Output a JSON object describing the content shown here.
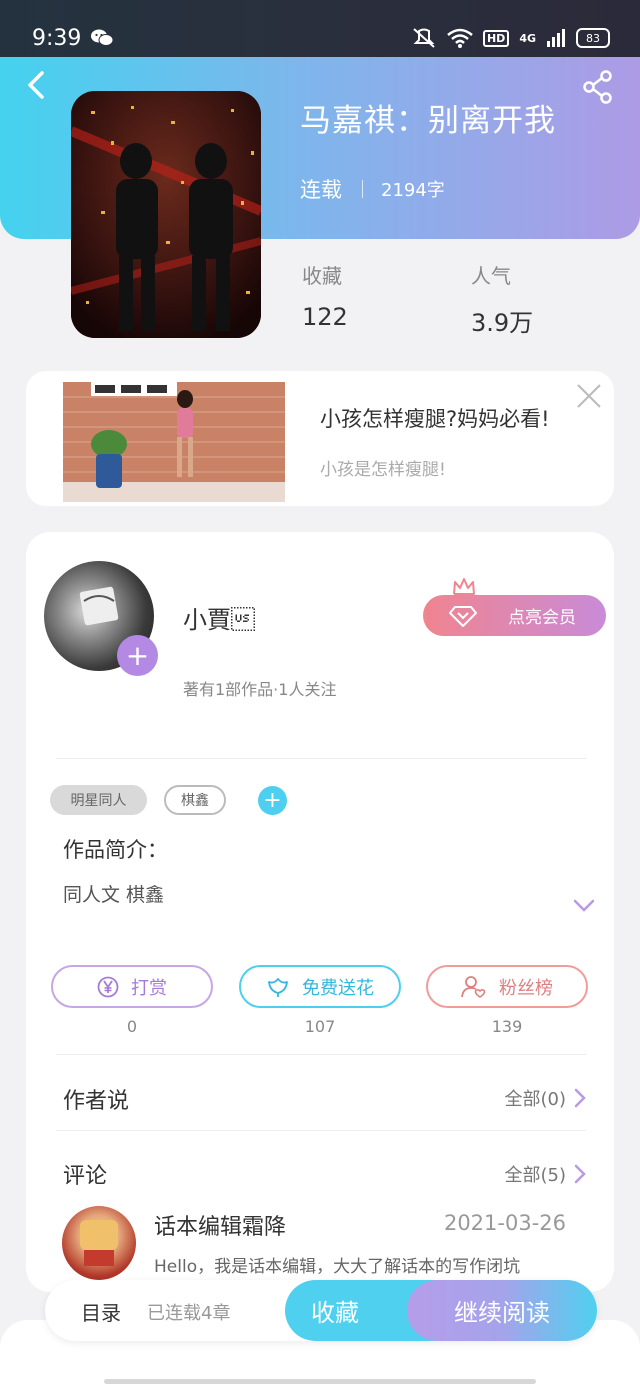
{
  "status_bar": {
    "time": "9:39",
    "network": "4G",
    "hd": "HD",
    "battery": "83"
  },
  "book": {
    "title": "马嘉祺：别离开我",
    "status": "连载",
    "word_count": "2194字"
  },
  "stats": [
    {
      "label": "收藏",
      "value": "122"
    },
    {
      "label": "人气",
      "value": "3.9万"
    }
  ],
  "ad": {
    "title": "小孩怎样瘦腿?妈妈必看!",
    "subtitle": "小孩是怎样瘦腿!"
  },
  "author": {
    "name": "小賈\u001f",
    "meta": "著有1部作品·1人关注",
    "vip_label": "点亮会员"
  },
  "tags": [
    "明星同人",
    "棋鑫"
  ],
  "intro": {
    "title": "作品简介：",
    "text": "同人文 棋鑫"
  },
  "actions": [
    {
      "label": "打赏",
      "count": "0",
      "icon": "yen-coin-icon"
    },
    {
      "label": "免费送花",
      "count": "107",
      "icon": "flower-icon"
    },
    {
      "label": "粉丝榜",
      "count": "139",
      "icon": "fan-user-icon"
    }
  ],
  "author_says": {
    "title": "作者说",
    "link": "全部(0)"
  },
  "comments": {
    "title": "评论",
    "link": "全部(5)",
    "items": [
      {
        "user": "话本编辑霜降",
        "date": "2021-03-26",
        "text": "Hello，我是话本编辑，大大了解话本的写作闭坑"
      }
    ]
  },
  "bottom": {
    "toc_label": "目录",
    "toc_sub": "已连载4章",
    "fav_label": "收藏",
    "read_label": "继续阅读"
  },
  "colors": {
    "accent_blue": "#4fd0ef",
    "accent_purple": "#b59de9",
    "vip_pink": "#f0848f"
  }
}
